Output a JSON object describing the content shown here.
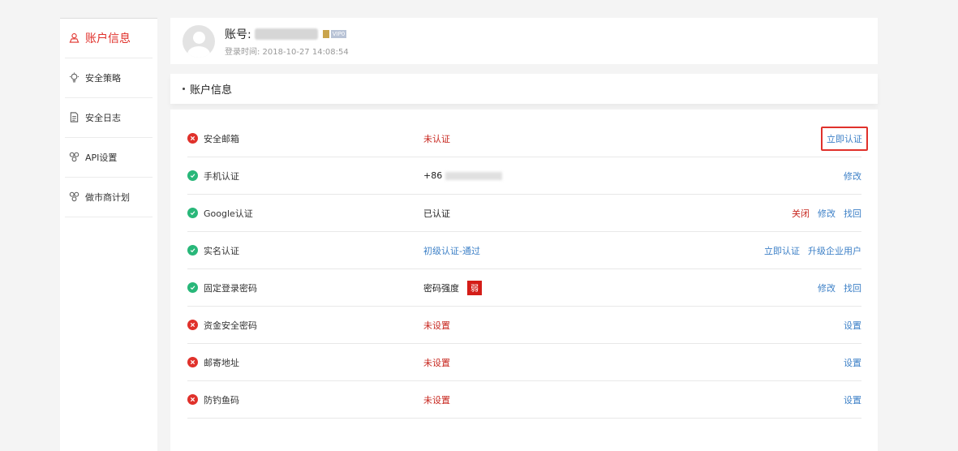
{
  "sidebar": {
    "items": [
      {
        "label": "账户信息",
        "icon": "user-icon",
        "active": true
      },
      {
        "label": "安全策略",
        "icon": "bulb-icon"
      },
      {
        "label": "安全日志",
        "icon": "document-icon"
      },
      {
        "label": "API设置",
        "icon": "link-icon"
      },
      {
        "label": "做市商计划",
        "icon": "link-icon"
      }
    ]
  },
  "header": {
    "account_prefix": "账号:",
    "vip_tag": "VIP0",
    "login_time": "登录时间: 2018-10-27 14:08:54"
  },
  "section": {
    "title": "账户信息"
  },
  "rows": [
    {
      "status": "bad",
      "label": "安全邮箱",
      "value": "未认证",
      "value_style": "red",
      "actions": [
        {
          "label": "立即认证",
          "style": "boxed"
        }
      ]
    },
    {
      "status": "good",
      "label": "手机认证",
      "value": "+86",
      "value_style": "dark",
      "actions": [
        {
          "label": "修改"
        }
      ]
    },
    {
      "status": "good",
      "label": "Google认证",
      "value": "已认证",
      "value_style": "dark",
      "actions": [
        {
          "label": "关闭",
          "style": "red"
        },
        {
          "label": "修改"
        },
        {
          "label": "找回"
        }
      ]
    },
    {
      "status": "good",
      "label": "实名认证",
      "value": "初级认证-通过",
      "value_style": "blue",
      "actions": [
        {
          "label": "立即认证"
        },
        {
          "label": "升级企业用户"
        }
      ]
    },
    {
      "status": "good",
      "label": "固定登录密码",
      "value": "密码强度",
      "value_style": "dark",
      "badge": "弱",
      "actions": [
        {
          "label": "修改"
        },
        {
          "label": "找回"
        }
      ]
    },
    {
      "status": "bad",
      "label": "资金安全密码",
      "value": "未设置",
      "value_style": "red",
      "actions": [
        {
          "label": "设置"
        }
      ]
    },
    {
      "status": "bad",
      "label": "邮寄地址",
      "value": "未设置",
      "value_style": "red",
      "actions": [
        {
          "label": "设置"
        }
      ]
    },
    {
      "status": "bad",
      "label": "防钓鱼码",
      "value": "未设置",
      "value_style": "red",
      "actions": [
        {
          "label": "设置"
        }
      ]
    }
  ],
  "colors": {
    "accent_red": "#e0312b",
    "link_blue": "#3d80c7",
    "success_green": "#28b779"
  }
}
